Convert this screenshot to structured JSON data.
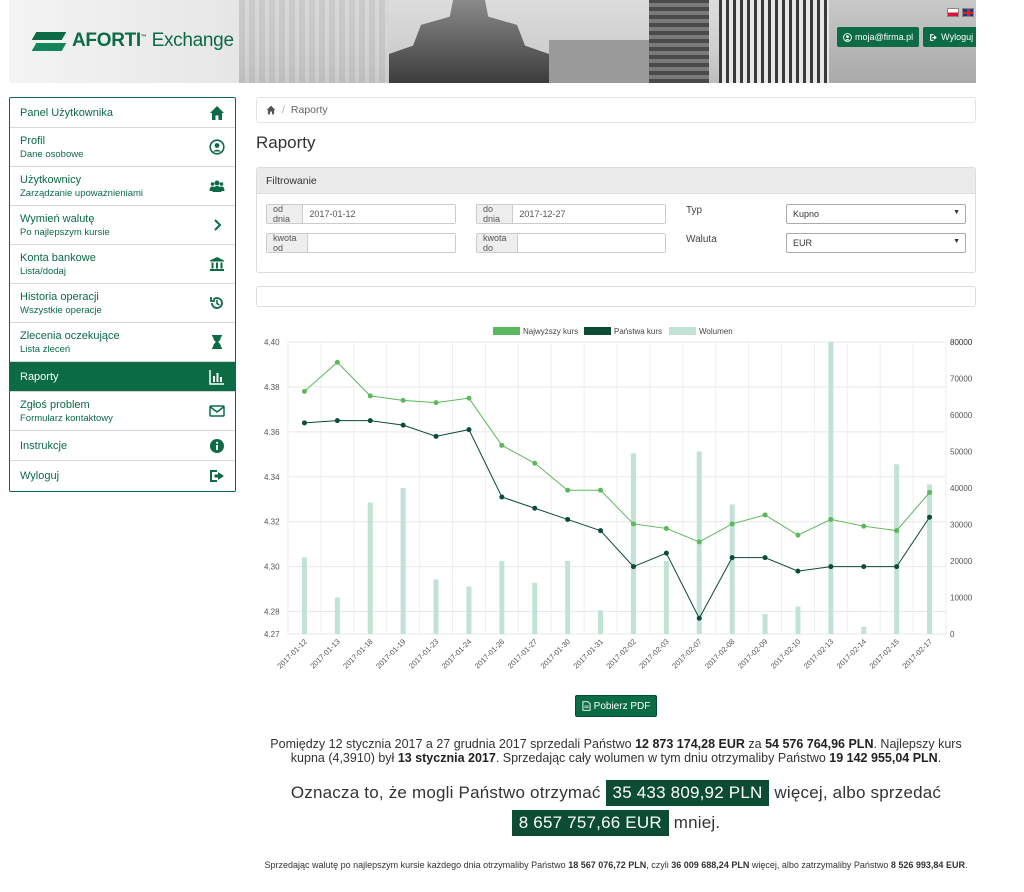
{
  "header": {
    "brand_name": "AFORTI",
    "brand_suffix": "Exchange",
    "account_label": "moja@firma.pl",
    "logout_label": "Wyloguj"
  },
  "sidebar": {
    "items": [
      {
        "title": "Panel Użytkownika",
        "subtitle": "",
        "icon": "home-icon"
      },
      {
        "title": "Profil",
        "subtitle": "Dane osobowe",
        "icon": "user-circle-icon"
      },
      {
        "title": "Użytkownicy",
        "subtitle": "Zarządzanie upoważnieniami",
        "icon": "users-icon"
      },
      {
        "title": "Wymień walutę",
        "subtitle": "Po najlepszym kursie",
        "icon": "chevron-right-icon"
      },
      {
        "title": "Konta bankowe",
        "subtitle": "Lista/dodaj",
        "icon": "bank-icon"
      },
      {
        "title": "Historia operacji",
        "subtitle": "Wszystkie operacje",
        "icon": "history-icon"
      },
      {
        "title": "Zlecenia oczekujące",
        "subtitle": "Lista zleceń",
        "icon": "hourglass-icon"
      },
      {
        "title": "Raporty",
        "subtitle": "",
        "icon": "bar-chart-icon",
        "active": true
      },
      {
        "title": "Zgłoś problem",
        "subtitle": "Formularz kontaktowy",
        "icon": "envelope-icon"
      },
      {
        "title": "Instrukcje",
        "subtitle": "",
        "icon": "info-icon"
      },
      {
        "title": "Wyloguj",
        "subtitle": "",
        "icon": "sign-out-icon"
      }
    ]
  },
  "breadcrumb": {
    "current": "Raporty"
  },
  "page_title": "Raporty",
  "filter": {
    "heading": "Filtrowanie",
    "date_from_label": "od dnia",
    "date_from_value": "2017-01-12",
    "date_to_label": "do dnia",
    "date_to_value": "2017-12-27",
    "amount_from_label": "kwota od",
    "amount_from_value": "",
    "amount_to_label": "kwota do",
    "amount_to_value": "",
    "type_label": "Typ",
    "type_value": "Kupno",
    "currency_label": "Waluta",
    "currency_value": "EUR"
  },
  "colors": {
    "accent": "#0b6b45",
    "best_rate": "#5cb85c",
    "your_rate": "#0b4c33",
    "volume": "#c2e3d4"
  },
  "chart_data": {
    "type": "line",
    "legend": [
      "Najwyższy kurs",
      "Państwa kurs",
      "Wolumen"
    ],
    "legend_position": "top-center",
    "grid": true,
    "x": [
      "2017-01-12",
      "2017-01-13",
      "2017-01-18",
      "2017-01-19",
      "2017-01-23",
      "2017-01-24",
      "2017-01-26",
      "2017-01-27",
      "2017-01-30",
      "2017-01-31",
      "2017-02-02",
      "2017-02-03",
      "2017-02-07",
      "2017-02-08",
      "2017-02-09",
      "2017-02-10",
      "2017-02-13",
      "2017-02-14",
      "2017-02-15",
      "2017-02-17"
    ],
    "series": [
      {
        "name": "Najwyższy kurs",
        "axis": "left",
        "values": [
          4.378,
          4.391,
          4.376,
          4.374,
          4.373,
          4.375,
          4.354,
          4.346,
          4.334,
          4.334,
          4.319,
          4.317,
          4.311,
          4.319,
          4.323,
          4.314,
          4.321,
          4.318,
          4.316,
          4.333
        ]
      },
      {
        "name": "Państwa kurs",
        "axis": "left",
        "values": [
          4.364,
          4.365,
          4.365,
          4.363,
          4.358,
          4.361,
          4.331,
          4.326,
          4.321,
          4.316,
          4.3,
          4.306,
          4.277,
          4.304,
          4.304,
          4.298,
          4.3,
          4.3,
          4.3,
          4.322
        ]
      },
      {
        "name": "Wolumen",
        "axis": "right",
        "type": "bar",
        "values": [
          21000,
          10000,
          36000,
          40000,
          15000,
          13000,
          20000,
          14000,
          20000,
          6500,
          49500,
          20000,
          50000,
          35500,
          5500,
          7500,
          80000,
          2000,
          46500,
          41000
        ]
      }
    ],
    "y_left": {
      "ticks": [
        "4.27",
        "4.28",
        "4.30",
        "4.32",
        "4.34",
        "4.36",
        "4.38",
        "4.40"
      ],
      "range": [
        4.27,
        4.4
      ]
    },
    "y_right": {
      "ticks": [
        "0",
        "10000",
        "20000",
        "30000",
        "40000",
        "50000",
        "60000",
        "70000",
        "80000",
        "80000"
      ],
      "range": [
        0,
        80000
      ]
    }
  },
  "pdf_button_label": "Pobierz PDF",
  "summary": {
    "s1_a": "Pomiędzy 12 stycznia 2017 a 27 grudnia 2017 sprzedali Państwo ",
    "s1_amount_eur": "12 873 174,28 EUR",
    "s1_b": " za ",
    "s1_amount_pln": "54 576 764,96 PLN",
    "s1_c": ". Najlepszy kurs kupna (4,3910) był ",
    "s1_best_date": "13 stycznia 2017",
    "s1_d": ". Sprzedając cały wolumen w tym dniu otrzymaliby Państwo ",
    "s1_best_total": "19 142 955,04 PLN",
    "s1_e": ".",
    "s2_a": "Oznacza to, że mogli Państwo otrzymać ",
    "s2_more_pln": "35 433 809,92 PLN",
    "s2_b": " więcej, albo sprzedać ",
    "s2_less_eur": "8 657 757,66 EUR",
    "s2_c": " mniej.",
    "s3_a": "Sprzedając walutę po najlepszym kursie każdego dnia otrzymaliby Państwo ",
    "s3_v1": "18 567 076,72 PLN",
    "s3_b": ", czyli ",
    "s3_v2": "36 009 688,24 PLN",
    "s3_c": " więcej, albo zatrzymaliby Państwo ",
    "s3_v3": "8 526 993,84 EUR",
    "s3_d": "."
  }
}
